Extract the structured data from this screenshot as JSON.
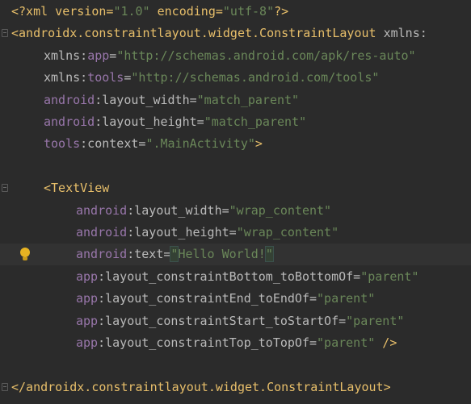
{
  "lines": [
    {
      "parts": [
        {
          "t": "<?xml version=",
          "c": "t-tag"
        },
        {
          "t": "\"1.0\"",
          "c": "t-str"
        },
        {
          "t": " encoding=",
          "c": "t-tag"
        },
        {
          "t": "\"utf-8\"",
          "c": "t-str"
        },
        {
          "t": "?>",
          "c": "t-tag"
        }
      ],
      "indent": 0
    },
    {
      "parts": [
        {
          "t": "<androidx.constraintlayout.widget.ConstraintLayout",
          "c": "t-tag"
        },
        {
          "t": " xmlns:",
          "c": "t-attr"
        }
      ],
      "indent": 0,
      "fold": true
    },
    {
      "parts": [
        {
          "t": "xmlns:",
          "c": "t-attr"
        },
        {
          "t": "app",
          "c": "t-ns"
        },
        {
          "t": "=",
          "c": "t-attr"
        },
        {
          "t": "\"http://schemas.android.com/apk/res-auto\"",
          "c": "t-str"
        }
      ],
      "indent": 1
    },
    {
      "parts": [
        {
          "t": "xmlns:",
          "c": "t-attr"
        },
        {
          "t": "tools",
          "c": "t-ns"
        },
        {
          "t": "=",
          "c": "t-attr"
        },
        {
          "t": "\"http://schemas.android.com/tools\"",
          "c": "t-str"
        }
      ],
      "indent": 1
    },
    {
      "parts": [
        {
          "t": "android",
          "c": "t-ns"
        },
        {
          "t": ":layout_width=",
          "c": "t-attr"
        },
        {
          "t": "\"match_parent\"",
          "c": "t-str"
        }
      ],
      "indent": 1
    },
    {
      "parts": [
        {
          "t": "android",
          "c": "t-ns"
        },
        {
          "t": ":layout_height=",
          "c": "t-attr"
        },
        {
          "t": "\"match_parent\"",
          "c": "t-str"
        }
      ],
      "indent": 1
    },
    {
      "parts": [
        {
          "t": "tools",
          "c": "t-ns"
        },
        {
          "t": ":context=",
          "c": "t-attr"
        },
        {
          "t": "\".MainActivity\"",
          "c": "t-str"
        },
        {
          "t": ">",
          "c": "t-tag"
        }
      ],
      "indent": 1
    },
    {
      "parts": [],
      "indent": 0
    },
    {
      "parts": [
        {
          "t": "<TextView",
          "c": "t-tag"
        }
      ],
      "indent": 1,
      "fold": true
    },
    {
      "parts": [
        {
          "t": "android",
          "c": "t-ns"
        },
        {
          "t": ":layout_width=",
          "c": "t-attr"
        },
        {
          "t": "\"wrap_content\"",
          "c": "t-str"
        }
      ],
      "indent": 2
    },
    {
      "parts": [
        {
          "t": "android",
          "c": "t-ns"
        },
        {
          "t": ":layout_height=",
          "c": "t-attr"
        },
        {
          "t": "\"wrap_content\"",
          "c": "t-str"
        }
      ],
      "indent": 2
    },
    {
      "parts": [
        {
          "t": "android",
          "c": "t-ns"
        },
        {
          "t": ":text=",
          "c": "t-attr"
        },
        {
          "t": "\"",
          "c": "t-qhl"
        },
        {
          "t": "Hello World!",
          "c": "t-str"
        },
        {
          "t": "\"",
          "c": "t-qhl"
        }
      ],
      "indent": 2,
      "current": true,
      "bulb": true
    },
    {
      "parts": [
        {
          "t": "app",
          "c": "t-ns"
        },
        {
          "t": ":layout_constraintBottom_toBottomOf=",
          "c": "t-attr"
        },
        {
          "t": "\"parent\"",
          "c": "t-str"
        }
      ],
      "indent": 2
    },
    {
      "parts": [
        {
          "t": "app",
          "c": "t-ns"
        },
        {
          "t": ":layout_constraintEnd_toEndOf=",
          "c": "t-attr"
        },
        {
          "t": "\"parent\"",
          "c": "t-str"
        }
      ],
      "indent": 2
    },
    {
      "parts": [
        {
          "t": "app",
          "c": "t-ns"
        },
        {
          "t": ":layout_constraintStart_toStartOf=",
          "c": "t-attr"
        },
        {
          "t": "\"parent\"",
          "c": "t-str"
        }
      ],
      "indent": 2
    },
    {
      "parts": [
        {
          "t": "app",
          "c": "t-ns"
        },
        {
          "t": ":layout_constraintTop_toTopOf=",
          "c": "t-attr"
        },
        {
          "t": "\"parent\"",
          "c": "t-str"
        },
        {
          "t": " />",
          "c": "t-tag"
        }
      ],
      "indent": 2
    },
    {
      "parts": [],
      "indent": 0
    },
    {
      "parts": [
        {
          "t": "</androidx.constraintlayout.widget.ConstraintLayout>",
          "c": "t-tag"
        }
      ],
      "indent": 0,
      "fold": true
    }
  ]
}
